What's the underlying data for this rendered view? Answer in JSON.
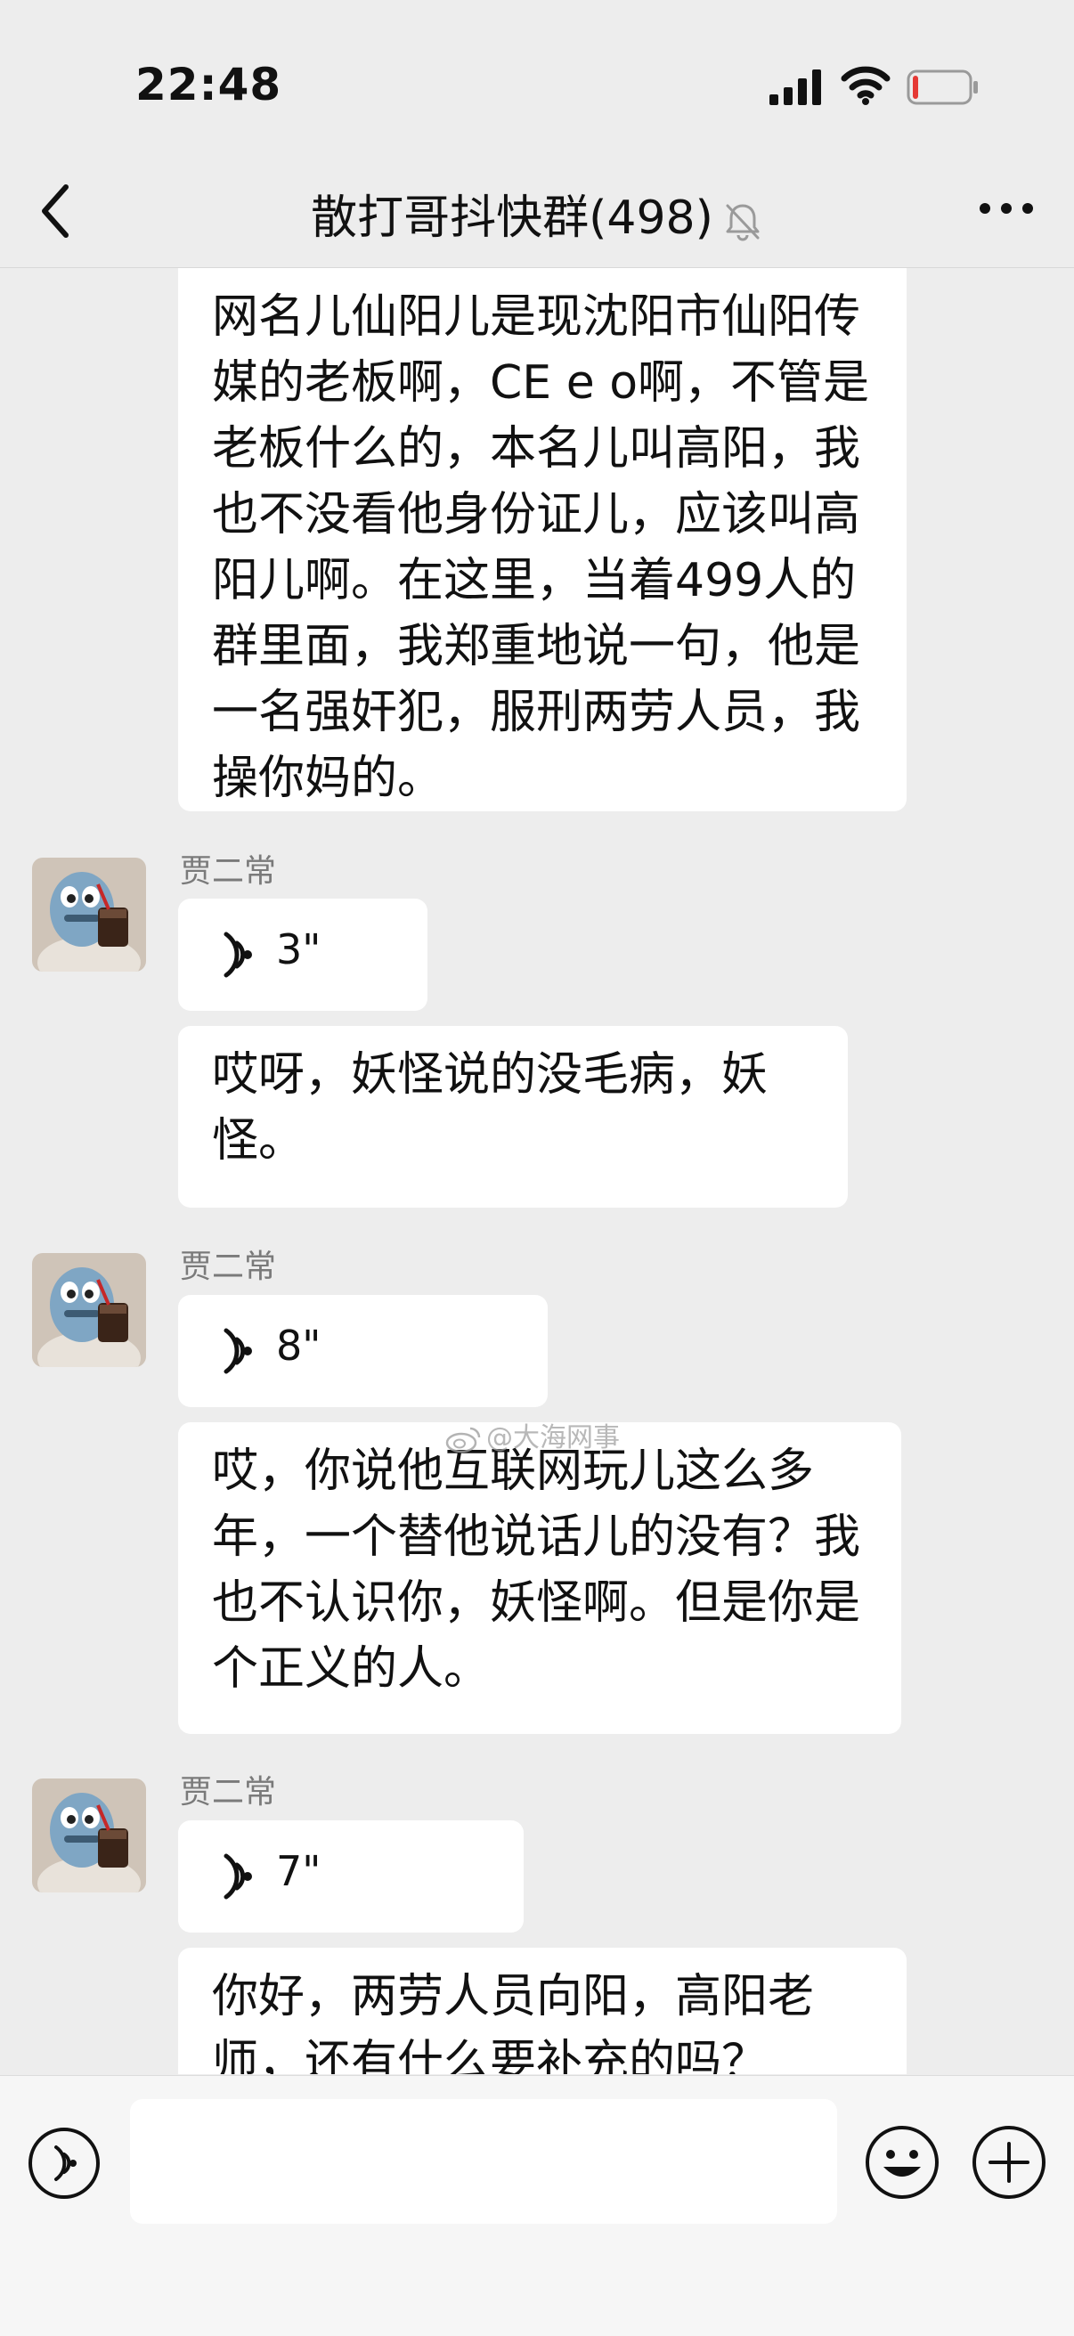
{
  "status_bar": {
    "time": "22:48",
    "battery_level": 0.1,
    "battery_color": "#e53935"
  },
  "nav": {
    "title": "散打哥抖快群(498)",
    "muted": true
  },
  "messages": [
    {
      "type": "text",
      "text": "网名儿仙阳儿是现沈阳市仙阳传媒的老板啊，CE e o啊，不管是老板什么的，本名儿叫高阳，我也不没看他身份证儿，应该叫高阳儿啊。在这里，当着499人的群里面，我郑重地说一句，他是一名强奸犯，服刑两劳人员，我操你妈的。"
    },
    {
      "type": "voice",
      "sender": "贾二常",
      "duration": "3\""
    },
    {
      "type": "text",
      "text": "哎呀，妖怪说的没毛病，妖怪。"
    },
    {
      "type": "voice",
      "sender": "贾二常",
      "duration": "8\""
    },
    {
      "type": "text",
      "text": "哎，你说他互联网玩儿这么多年，一个替他说话儿的没有？我也不认识你，妖怪啊。但是你是个正义的人。"
    },
    {
      "type": "voice",
      "sender": "贾二常",
      "duration": "7\""
    },
    {
      "type": "text",
      "text": "你好，两劳人员向阳，高阳老师，还有什么要补充的吗？"
    }
  ],
  "watermark": "@大海网事",
  "input": {
    "placeholder": ""
  },
  "icons": {
    "back": "chevron-left-icon",
    "mute": "bell-off-icon",
    "more": "more-dots-icon",
    "voice": "voice-wave-icon",
    "emoji": "smiley-icon",
    "plus": "plus-circle-icon"
  }
}
